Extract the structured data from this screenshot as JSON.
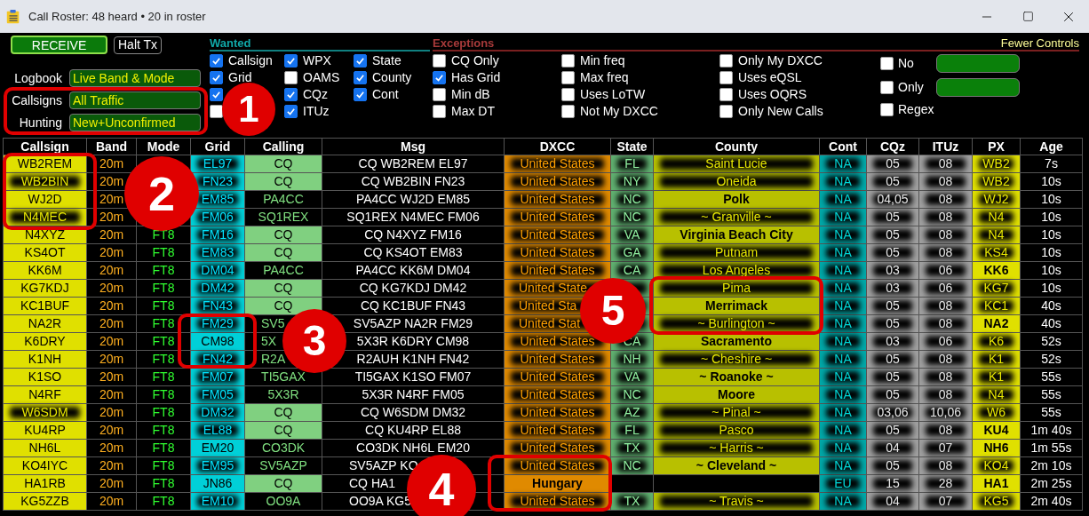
{
  "window": {
    "title": "Call Roster: 48 heard • 20 in roster"
  },
  "controls": {
    "receive_button": "RECEIVE",
    "halt_button": "Halt Tx",
    "fields": [
      {
        "label": "Logbook",
        "value": "Live Band & Mode"
      },
      {
        "label": "Callsigns",
        "value": "All Traffic"
      },
      {
        "label": "Hunting",
        "value": "New+Unconfirmed"
      }
    ]
  },
  "wanted": {
    "title": "Wanted",
    "columns": [
      [
        {
          "label": "Callsign",
          "checked": true
        },
        {
          "label": "Grid",
          "checked": true
        },
        {
          "checked": true
        },
        {
          "checked": false
        }
      ],
      [
        {
          "label": "WPX",
          "checked": true
        },
        {
          "label": "OAMS",
          "checked": false
        },
        {
          "label": "CQz",
          "checked": true
        },
        {
          "label": "ITUz",
          "checked": true
        }
      ],
      [
        {
          "label": "State",
          "checked": true
        },
        {
          "label": "County",
          "checked": true
        },
        {
          "label": "Cont",
          "checked": true
        }
      ]
    ]
  },
  "exceptions": {
    "title": "Exceptions",
    "link": "Fewer Controls",
    "columns": [
      [
        {
          "label": "CQ Only",
          "checked": false
        },
        {
          "label": "Has Grid",
          "checked": true
        },
        {
          "label": "Min dB",
          "checked": false
        },
        {
          "label": "Max DT",
          "checked": false
        }
      ],
      [
        {
          "label": "Min freq",
          "checked": false
        },
        {
          "label": "Max freq",
          "checked": false
        },
        {
          "label": "Uses LoTW",
          "checked": false
        },
        {
          "label": "Not My DXCC",
          "checked": false
        }
      ],
      [
        {
          "label": "Only My DXCC",
          "checked": false
        },
        {
          "label": "Uses eQSL",
          "checked": false
        },
        {
          "label": "Uses OQRS",
          "checked": false
        },
        {
          "label": "Only New Calls",
          "checked": false
        }
      ]
    ],
    "filters": [
      {
        "kind": "field",
        "label": "No",
        "checked": false
      },
      {
        "kind": "field",
        "label": "Only",
        "checked": false
      },
      {
        "kind": "plain",
        "label": "Regex",
        "checked": false
      }
    ]
  },
  "table": {
    "columns": [
      "Callsign",
      "Band",
      "Mode",
      "Grid",
      "Calling",
      "Msg",
      "DXCC",
      "State",
      "County",
      "Cont",
      "CQz",
      "ITUz",
      "PX",
      "Age"
    ],
    "rows": [
      {
        "callsign": "WB2REM",
        "callsign_glow": false,
        "band": "20m",
        "grid": "EL97",
        "grid_glow": true,
        "calling": "CQ",
        "calling_cq": true,
        "msg": "CQ WB2REM EL97",
        "dxcc": "United States",
        "dxcc_glow": true,
        "state": "FL",
        "county": "Saint Lucie",
        "county_glow": true,
        "cont": "NA",
        "cqz": "05",
        "ituz": "08",
        "px": "WB2",
        "px_glow": true,
        "age": "7s"
      },
      {
        "callsign": "WB2BIN",
        "callsign_glow": true,
        "band": "20m",
        "grid": "FN23",
        "grid_glow": true,
        "calling": "CQ",
        "calling_cq": true,
        "msg": "CQ WB2BIN FN23",
        "dxcc": "United States",
        "dxcc_glow": true,
        "state": "NY",
        "county": "Oneida",
        "county_glow": true,
        "cont": "NA",
        "cqz": "05",
        "ituz": "08",
        "px": "WB2",
        "px_glow": true,
        "age": "10s"
      },
      {
        "callsign": "WJ2D",
        "callsign_glow": false,
        "band": "20m",
        "grid": "EM85",
        "grid_glow": true,
        "calling": "PA4CC",
        "calling_cq": false,
        "msg": "PA4CC WJ2D EM85",
        "dxcc": "United States",
        "dxcc_glow": true,
        "state": "NC",
        "county": "Polk",
        "county_glow": false,
        "cont": "NA",
        "cqz": "04,05",
        "ituz": "08",
        "px": "WJ2",
        "px_glow": true,
        "age": "10s"
      },
      {
        "callsign": "N4MEC",
        "callsign_glow": true,
        "band": "20m",
        "grid": "FM06",
        "grid_glow": true,
        "calling": "SQ1REX",
        "calling_cq": false,
        "msg": "SQ1REX N4MEC FM06",
        "dxcc": "United States",
        "dxcc_glow": true,
        "state": "NC",
        "county": "~ Granville ~",
        "county_glow": true,
        "cont": "NA",
        "cqz": "05",
        "ituz": "08",
        "px": "N4",
        "px_glow": true,
        "age": "10s"
      },
      {
        "callsign": "N4XYZ",
        "callsign_glow": false,
        "band": "20m",
        "mode": "FT8",
        "grid": "FM16",
        "grid_glow": true,
        "calling": "CQ",
        "calling_cq": true,
        "msg": "CQ N4XYZ FM16",
        "dxcc": "United States",
        "dxcc_glow": true,
        "state": "VA",
        "county": "Virginia Beach City",
        "county_glow": false,
        "cont": "NA",
        "cqz": "05",
        "ituz": "08",
        "px": "N4",
        "px_glow": true,
        "age": "10s"
      },
      {
        "callsign": "KS4OT",
        "callsign_glow": false,
        "band": "20m",
        "mode": "FT8",
        "grid": "EM83",
        "grid_glow": true,
        "calling": "CQ",
        "calling_cq": true,
        "msg": "CQ KS4OT EM83",
        "dxcc": "United States",
        "dxcc_glow": true,
        "state": "GA",
        "county": "Putnam",
        "county_glow": true,
        "cont": "NA",
        "cqz": "05",
        "ituz": "08",
        "px": "KS4",
        "px_glow": true,
        "age": "10s"
      },
      {
        "callsign": "KK6M",
        "callsign_glow": false,
        "band": "20m",
        "mode": "FT8",
        "grid": "DM04",
        "grid_glow": true,
        "calling": "PA4CC",
        "calling_cq": false,
        "msg": "PA4CC KK6M DM04",
        "dxcc": "United States",
        "dxcc_glow": true,
        "state": "CA",
        "county": "Los Angeles",
        "county_glow": true,
        "cont": "NA",
        "cqz": "03",
        "ituz": "06",
        "px": "KK6",
        "px_glow": false,
        "age": "10s"
      },
      {
        "callsign": "KG7KDJ",
        "callsign_glow": false,
        "band": "20m",
        "mode": "FT8",
        "grid": "DM42",
        "grid_glow": true,
        "calling": "CQ",
        "calling_cq": true,
        "msg": "CQ KG7KDJ DM42",
        "dxcc": "United State",
        "dxcc_glow": true,
        "dxcc_cut": true,
        "county": "Pima",
        "county_glow": true,
        "cont": "NA",
        "cqz": "03",
        "ituz": "06",
        "px": "KG7",
        "px_glow": true,
        "age": "10s"
      },
      {
        "callsign": "KC1BUF",
        "callsign_glow": false,
        "band": "20m",
        "mode": "FT8",
        "grid": "FN43",
        "grid_glow": true,
        "calling": "CQ",
        "calling_cq": true,
        "msg": "CQ KC1BUF FN43",
        "dxcc": "United Sta",
        "dxcc_glow": true,
        "dxcc_cut": true,
        "county": "Merrimack",
        "county_glow": false,
        "cont": "NA",
        "cqz": "05",
        "ituz": "08",
        "px": "KC1",
        "px_glow": true,
        "age": "40s"
      },
      {
        "callsign": "NA2R",
        "callsign_glow": false,
        "band": "20m",
        "mode": "FT8",
        "grid": "FM29",
        "grid_glow": true,
        "calling": "SV5",
        "calling_cq": false,
        "calling_cut": true,
        "msg": "SV5AZP NA2R FM29",
        "dxcc": "United Stat",
        "dxcc_glow": true,
        "dxcc_cut": true,
        "county": "~ Burlington ~",
        "county_glow": true,
        "cont": "NA",
        "cqz": "05",
        "ituz": "08",
        "px": "NA2",
        "px_glow": false,
        "age": "40s"
      },
      {
        "callsign": "K6DRY",
        "callsign_glow": false,
        "band": "20m",
        "mode": "FT8",
        "grid": "CM98",
        "grid_glow": false,
        "calling": "5X",
        "calling_cq": false,
        "calling_cut": true,
        "msg": "5X3R K6DRY CM98",
        "dxcc": "United States",
        "dxcc_glow": true,
        "state": "CA",
        "county": "Sacramento",
        "county_glow": false,
        "cont": "NA",
        "cqz": "03",
        "ituz": "06",
        "px": "K6",
        "px_glow": true,
        "age": "52s"
      },
      {
        "callsign": "K1NH",
        "callsign_glow": false,
        "band": "20m",
        "mode": "FT8",
        "grid": "FN42",
        "grid_glow": true,
        "calling": "R2A",
        "calling_cq": false,
        "calling_cut": true,
        "msg": "R2AUH K1NH FN42",
        "dxcc": "United States",
        "dxcc_glow": true,
        "state": "NH",
        "county": "~ Cheshire ~",
        "county_glow": true,
        "cont": "NA",
        "cqz": "05",
        "ituz": "08",
        "px": "K1",
        "px_glow": true,
        "age": "52s"
      },
      {
        "callsign": "K1SO",
        "callsign_glow": false,
        "band": "20m",
        "mode": "FT8",
        "grid": "FM07",
        "grid_glow": true,
        "calling": "TI5GAX",
        "calling_cq": false,
        "msg": "TI5GAX K1SO FM07",
        "dxcc": "United States",
        "dxcc_glow": true,
        "state": "VA",
        "county": "~ Roanoke ~",
        "county_glow": false,
        "cont": "NA",
        "cqz": "05",
        "ituz": "08",
        "px": "K1",
        "px_glow": true,
        "age": "55s"
      },
      {
        "callsign": "N4RF",
        "callsign_glow": false,
        "band": "20m",
        "mode": "FT8",
        "grid": "FM05",
        "grid_glow": true,
        "calling": "5X3R",
        "calling_cq": false,
        "msg": "5X3R N4RF FM05",
        "dxcc": "United States",
        "dxcc_glow": true,
        "state": "NC",
        "county": "Moore",
        "county_glow": false,
        "cont": "NA",
        "cqz": "05",
        "ituz": "08",
        "px": "N4",
        "px_glow": true,
        "age": "55s"
      },
      {
        "callsign": "W6SDM",
        "callsign_glow": true,
        "band": "20m",
        "mode": "FT8",
        "grid": "DM32",
        "grid_glow": true,
        "calling": "CQ",
        "calling_cq": true,
        "msg": "CQ W6SDM DM32",
        "dxcc": "United States",
        "dxcc_glow": true,
        "state": "AZ",
        "county": "~ Pinal ~",
        "county_glow": true,
        "cont": "NA",
        "cqz": "03,06",
        "ituz": "10,06",
        "px": "W6",
        "px_glow": true,
        "age": "55s"
      },
      {
        "callsign": "KU4RP",
        "callsign_glow": false,
        "band": "20m",
        "mode": "FT8",
        "grid": "EL88",
        "grid_glow": true,
        "calling": "CQ",
        "calling_cq": true,
        "msg": "CQ KU4RP EL88",
        "dxcc": "United States",
        "dxcc_glow": true,
        "state": "FL",
        "county": "Pasco",
        "county_glow": true,
        "cont": "NA",
        "cqz": "05",
        "ituz": "08",
        "px": "KU4",
        "px_glow": false,
        "age": "1m 40s"
      },
      {
        "callsign": "NH6L",
        "callsign_glow": false,
        "band": "20m",
        "mode": "FT8",
        "grid": "EM20",
        "grid_glow": false,
        "calling": "CO3DK",
        "calling_cq": false,
        "msg": "CO3DK NH6L EM20",
        "dxcc": "United States",
        "dxcc_glow": true,
        "state": "TX",
        "county": "~ Harris ~",
        "county_glow": true,
        "cont": "NA",
        "cqz": "04",
        "ituz": "07",
        "px": "NH6",
        "px_glow": false,
        "age": "1m 55s"
      },
      {
        "callsign": "KO4IYC",
        "callsign_glow": false,
        "band": "20m",
        "mode": "FT8",
        "grid": "EM95",
        "grid_glow": true,
        "calling": "SV5AZP",
        "calling_cq": false,
        "msg": "SV5AZP KO",
        "msg_cut": true,
        "dxcc": "United States",
        "dxcc_glow": true,
        "state": "NC",
        "county": "~ Cleveland ~",
        "county_glow": false,
        "cont": "NA",
        "cqz": "05",
        "ituz": "08",
        "px": "KO4",
        "px_glow": true,
        "age": "2m 10s"
      },
      {
        "callsign": "HA1RB",
        "callsign_glow": false,
        "band": "20m",
        "mode": "FT8",
        "grid": "JN86",
        "grid_glow": false,
        "calling": "CQ",
        "calling_cq": true,
        "msg": "CQ HA1",
        "msg_cut": true,
        "dxcc": "Hungary",
        "dxcc_glow": false,
        "cont": "EU",
        "cqz": "15",
        "ituz": "28",
        "px": "HA1",
        "px_glow": false,
        "age": "2m 25s"
      },
      {
        "callsign": "KG5ZZB",
        "callsign_glow": false,
        "band": "20m",
        "mode": "FT8",
        "grid": "EM10",
        "grid_glow": true,
        "calling": "OO9A",
        "calling_cq": false,
        "msg": "OO9A KG5",
        "msg_cut": true,
        "dxcc": "United States",
        "dxcc_glow": true,
        "state": "TX",
        "county": "~ Travis ~",
        "county_glow": true,
        "cont": "NA",
        "cqz": "04",
        "ituz": "07",
        "px": "KG5",
        "px_glow": true,
        "age": "2m 40s"
      }
    ]
  },
  "callouts": [
    {
      "number": "1"
    },
    {
      "number": "2"
    },
    {
      "number": "3"
    },
    {
      "number": "4"
    },
    {
      "number": "5"
    }
  ]
}
